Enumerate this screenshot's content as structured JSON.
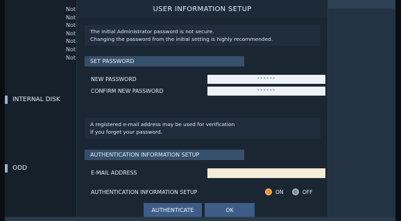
{
  "background": {
    "status_list": [
      "Not",
      "Not",
      "Not",
      "Not",
      "Not",
      "Not",
      "Not"
    ],
    "sidebar_items": [
      {
        "label": "INTERNAL DISK",
        "icon": "disk-icon"
      },
      {
        "label": "ODD",
        "icon": "disc-drive-icon"
      }
    ]
  },
  "dialog": {
    "title": "USER INFORMATION SETUP",
    "warning_line1": "The initial Administrator password is not secure.",
    "warning_line2": "Changing the password from the initial setting is highly recommended.",
    "set_password_header": "SET PASSWORD",
    "new_password_label": "NEW PASSWORD",
    "new_password_value": "******",
    "confirm_password_label": "CONFIRM NEW PASSWORD",
    "confirm_password_value": "******",
    "email_note_line1": "A registered e-mail address may be used for verification",
    "email_note_line2": "if you forget your password.",
    "auth_header": "AUTHENTICATION INFORMATION SETUP",
    "email_label": "E-MAIL ADDRESS",
    "email_value": "",
    "auth_setup_label": "AUTHENTICATION INFORMATION SETUP",
    "radio_on": "ON",
    "radio_off": "OFF",
    "authenticate_button": "AUTHENTICATE",
    "ok_button": "OK"
  },
  "colors": {
    "dialog_bg": "#1b2633",
    "section_bg": "#36506c",
    "button_bg": "#3d5d86",
    "radio_selected": "#f08a24"
  }
}
